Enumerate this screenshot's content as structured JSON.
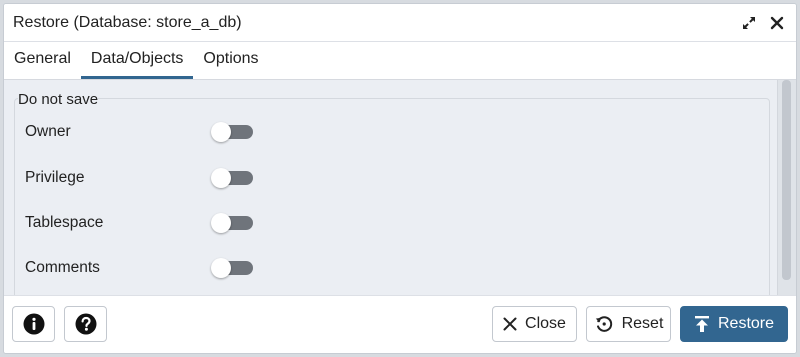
{
  "dialog": {
    "title": "Restore (Database: store_a_db)",
    "icons": {
      "expand": "expand-icon",
      "close": "close-x-icon"
    }
  },
  "tabs": [
    {
      "label": "General",
      "active": false
    },
    {
      "label": "Data/Objects",
      "active": true
    },
    {
      "label": "Options",
      "active": false
    }
  ],
  "section": {
    "legend": "Do not save",
    "toggles": [
      {
        "label": "Owner",
        "on": false
      },
      {
        "label": "Privilege",
        "on": false
      },
      {
        "label": "Tablespace",
        "on": false
      },
      {
        "label": "Comments",
        "on": false
      }
    ]
  },
  "footer": {
    "info_icon": "info-icon",
    "help_icon": "help-icon",
    "close_label": "Close",
    "reset_label": "Reset",
    "restore_label": "Restore"
  },
  "colors": {
    "primary": "#326690",
    "toggle_off_track": "#6f747b",
    "panel_bg": "#ebeef3"
  }
}
